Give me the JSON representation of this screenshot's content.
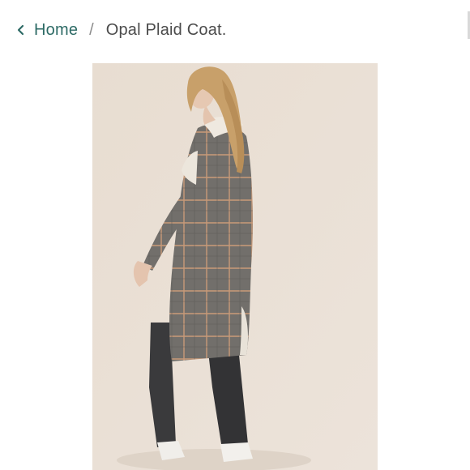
{
  "breadcrumb": {
    "back_icon": "chevron-left-icon",
    "home_label": "Home",
    "separator": "/",
    "current_label": "Opal Plaid Coat."
  },
  "product_image": {
    "subject": "woman wearing plaid coat",
    "background_color": "#e9dfd4"
  },
  "colors": {
    "link": "#2e6b66",
    "text": "#4b4b4b",
    "separator": "#8c8c8c"
  }
}
